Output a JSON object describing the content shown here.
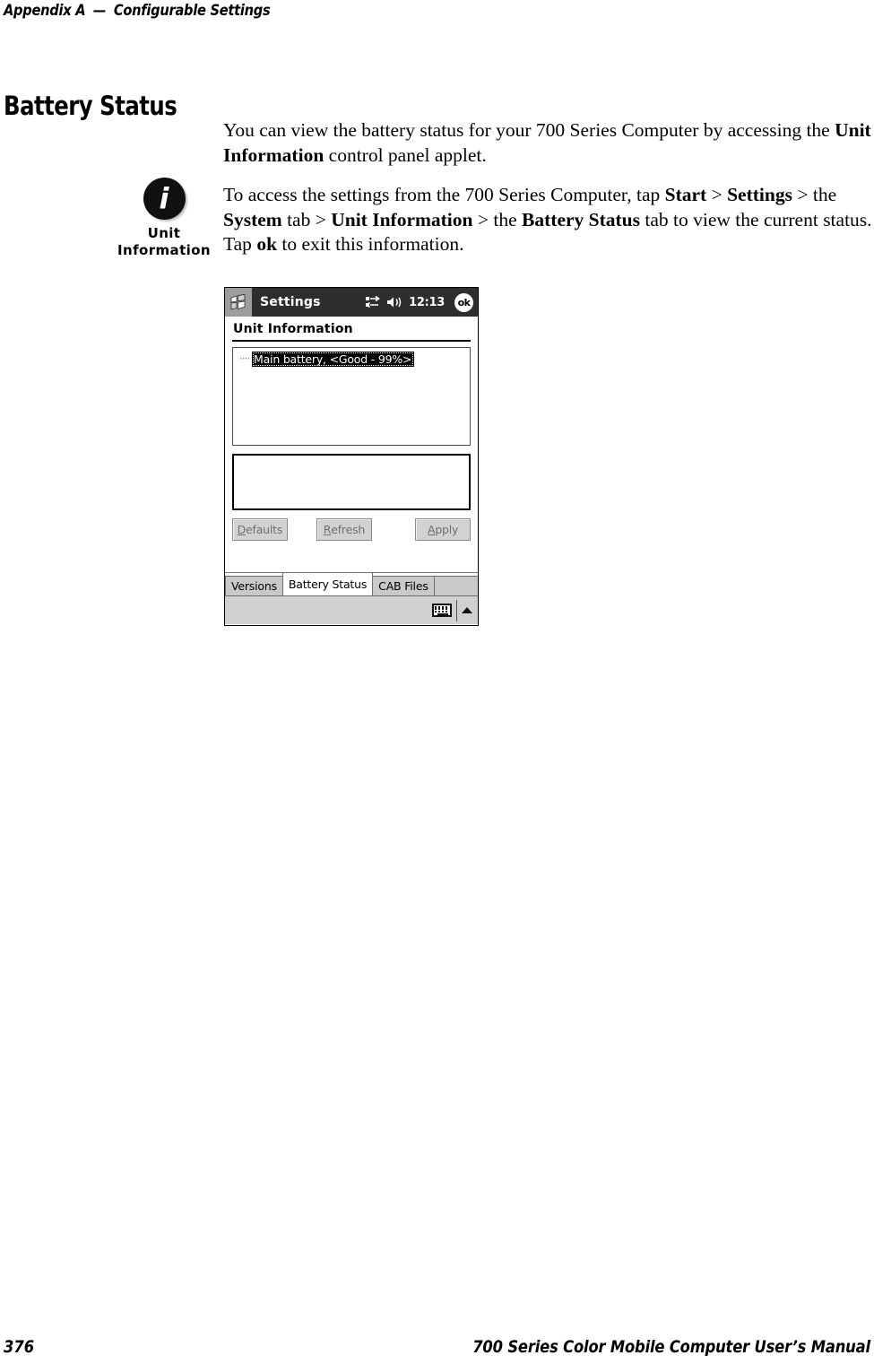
{
  "page": {
    "running_head_left": "Appendix A",
    "running_head_sep": "—",
    "running_head_right": "Configurable Settings",
    "section_heading": "Battery Status",
    "folio_number": "376",
    "folio_title": "700 Series Color Mobile Computer User’s Manual"
  },
  "body": {
    "paragraph_1_part1": "You can view the battery status for your 700 Series Computer by accessing the ",
    "paragraph_1_bold1": "Unit Information",
    "paragraph_1_part2": " control panel applet.",
    "paragraph_2_part1": "To access the settings from the 700 Series Computer, tap ",
    "paragraph_2_bold1": "Start",
    "paragraph_2_part2": " > ",
    "paragraph_2_bold2": "Settings",
    "paragraph_2_part3": " > the ",
    "paragraph_2_bold3": "System",
    "paragraph_2_part4": " tab > ",
    "paragraph_2_bold4": "Unit Information",
    "paragraph_2_part5": " > the ",
    "paragraph_2_bold5": "Battery Status",
    "paragraph_2_part6": " tab to view the current status. Tap ",
    "paragraph_2_bold6": "ok",
    "paragraph_2_part7": " to exit this information."
  },
  "margin_icon": {
    "glyph": "info-icon",
    "caption_line1": "Unit",
    "caption_line2": "Information"
  },
  "pda": {
    "titlebar": {
      "logo": "windows-logo-icon",
      "title": "Settings",
      "connectivity_icon": "connectivity-icon",
      "volume_icon": "speaker-icon",
      "clock": "12:13",
      "ok_label": "ok"
    },
    "panel_title": "Unit Information",
    "tree_items": [
      {
        "label": "Main battery, <Good - 99%>",
        "selected": true
      }
    ],
    "detail_text": "",
    "buttons": [
      {
        "accel": "D",
        "rest": "efaults",
        "name": "defaults-button",
        "enabled": false
      },
      {
        "accel": "R",
        "rest": "efresh",
        "name": "refresh-button",
        "enabled": false
      },
      {
        "accel": "A",
        "rest": "pply",
        "name": "apply-button",
        "enabled": false
      }
    ],
    "tabs": [
      {
        "label": "Versions",
        "active": false
      },
      {
        "label": "Battery Status",
        "active": true
      },
      {
        "label": "CAB Files",
        "active": false
      }
    ],
    "sip": {
      "keyboard_icon": "keyboard-icon",
      "arrow_icon": "chevron-up-icon"
    }
  },
  "colors": {
    "titlebar_bg": "#2e2e2e",
    "selection_bg": "#000000",
    "button_face": "#d2d2d2",
    "tab_inactive": "#c9c9c9",
    "sip_bar": "#d0d0d0"
  }
}
